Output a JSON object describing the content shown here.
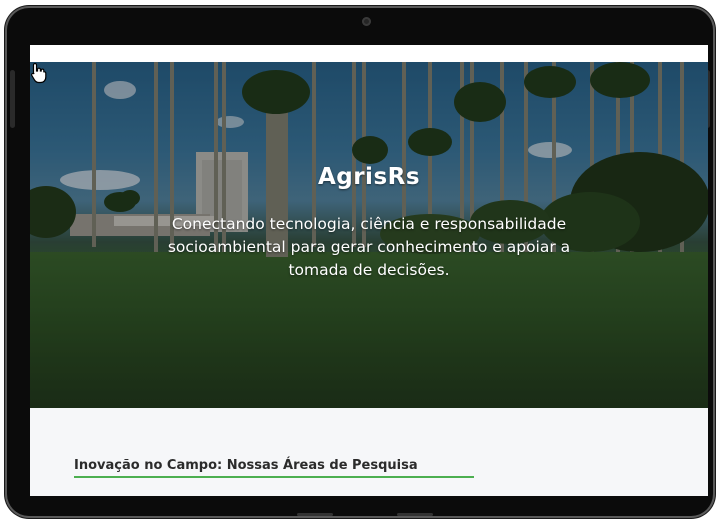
{
  "hero": {
    "title": "AgrisRs",
    "subtitle": "Conectando tecnologia, ciência e responsabilidade socioambiental para gerar conhecimento e apoiar a tomada de decisões."
  },
  "section": {
    "title": "Inovação no Campo: Nossas Áreas de Pesquisa"
  },
  "colors": {
    "accent": "#4caf50",
    "hero_text": "#ffffff",
    "section_bg": "#f6f7f9",
    "device_frame": "#0b0b0b"
  },
  "icons": {
    "cursor": "hand-pointer-icon"
  }
}
